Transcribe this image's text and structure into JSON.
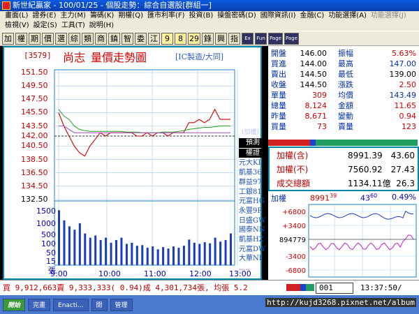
{
  "window_title": "新世紀贏家 - 100/01/25 - 個股走勢：綜合自選股[群組一]",
  "menu": {
    "row1": [
      {
        "label": "畫面(L)",
        "enabled": true
      },
      {
        "label": "證券(E)",
        "enabled": true
      },
      {
        "label": "主力(M)",
        "enabled": true
      },
      {
        "label": "籌碼(K)",
        "enabled": true
      },
      {
        "label": "期權(Q)",
        "enabled": true
      },
      {
        "label": "匯市利率(F)",
        "enabled": true
      },
      {
        "label": "投資(B)",
        "enabled": true
      },
      {
        "label": "操盤密碼(D)",
        "enabled": true
      },
      {
        "label": "國際資訊(I)",
        "enabled": true
      },
      {
        "label": "金融(C)",
        "enabled": true
      },
      {
        "label": "功能選擇(A)",
        "enabled": true
      },
      {
        "label": "功能選擇(J)",
        "enabled": false
      }
    ],
    "row2": [
      {
        "label": "檢視(V)",
        "enabled": true
      },
      {
        "label": "設定(S)",
        "enabled": true
      },
      {
        "label": "工具(T)",
        "enabled": true
      },
      {
        "label": "說明(H)",
        "enabled": true
      }
    ]
  },
  "toolbar": {
    "buttons": [
      "加",
      "權",
      "期",
      "價",
      "選",
      "綜",
      "類",
      "商",
      "鎮",
      "智",
      "委",
      "江",
      "9",
      "8",
      "29",
      "錄",
      "興",
      "指"
    ],
    "extra": [
      "Ex",
      "Fun",
      "Page",
      "Page"
    ]
  },
  "quote": {
    "code": "[3579]",
    "name": "尚志",
    "title": "量價走勢圖",
    "industry": "[IC製造/大同]",
    "rows": [
      {
        "l1": "開盤",
        "v1": "146.00",
        "l2": "振幅",
        "v2": "5.63%",
        "v2c": "red"
      },
      {
        "l1": "買進",
        "v1": "144.00",
        "l2": "最高",
        "v2": "147.00",
        "v2c": "blue"
      },
      {
        "l1": "賣出",
        "v1": "144.50",
        "l2": "最低",
        "v2": "139.00",
        "v2c": "black"
      },
      {
        "l1": "收盤",
        "v1": "144.50",
        "l2": "漲跌",
        "v2": "2.50",
        "v2c": "red"
      },
      {
        "l1": "單量",
        "v1": "309",
        "l2": "均價",
        "v2": "143.49",
        "v2c": "blue"
      },
      {
        "l1": "總量",
        "v1": "8,124",
        "l2": "金額",
        "v2": "11.65",
        "v2c": "red"
      },
      {
        "l1": "昨量",
        "v1": "8,671",
        "l2": "變動",
        "v2": "0.94",
        "v2c": "red"
      },
      {
        "l1": "買量",
        "v1": "73",
        "l2": "賣量",
        "v2": "123",
        "v2c": "red"
      }
    ]
  },
  "price_axis": [
    "151.50",
    "149.50",
    "147.50",
    "145.50",
    "143.50",
    "142.00",
    "140.50",
    "138.50",
    "136.50",
    "134.50",
    "132.50"
  ],
  "volume_axis": [
    "1500",
    "1000",
    "500",
    "100",
    "50",
    "15"
  ],
  "volume_unit": "張",
  "time_axis": [
    "9:00",
    "10:00",
    "11:00",
    "12:00",
    "13:00"
  ],
  "weighted_label": "(加權)",
  "broker_header": "預測",
  "broker_subheader": "權證",
  "brokers": [
    "元大KI",
    "凱基36",
    "群益97",
    "工銀81",
    "元富HG",
    "永豐9P",
    "日盛GW",
    "國泰NN",
    "凱基HZ",
    "元富DW",
    "大華NI",
    "....."
  ],
  "summary": [
    {
      "label": "加權(含)",
      "value": "8991.39",
      "pct": "43.60"
    },
    {
      "label": "加權(不)",
      "value": "7560.92",
      "pct": "27.43"
    },
    {
      "label": "成交總額",
      "value": "1134.11億",
      "pct": "26.3"
    }
  ],
  "mini": {
    "label": "加權",
    "price": "8991",
    "price_sup": "39",
    "change": "43",
    "change_sup": "60",
    "pct": "0.49%",
    "yticks": [
      "+6800",
      "+3400",
      "894779",
      "-3400",
      "-6800"
    ]
  },
  "status": {
    "text": "買 9,912,663賣 9,333,333( 0.94)成 4,301,734張, 均張 5.2",
    "input": "001",
    "time": "13:37:50/"
  },
  "taskbar": {
    "start": "開始",
    "items": [
      "完畫",
      "Enacti...",
      "開",
      "管理"
    ]
  },
  "watermark": "http://kujd3268.pixnet.net/album",
  "chart_data": {
    "type": "line",
    "price_reference": 142.0,
    "ylim": [
      132.5,
      151.5
    ],
    "times": [
      "9:00",
      "9:05",
      "9:10",
      "9:15",
      "9:20",
      "9:25",
      "9:30",
      "9:35",
      "9:40",
      "9:45",
      "9:50",
      "9:55",
      "10:00",
      "10:10",
      "10:20",
      "10:30",
      "10:40",
      "10:50",
      "11:00",
      "11:10",
      "11:20",
      "11:30",
      "11:40",
      "11:50",
      "12:00",
      "12:10",
      "12:20",
      "12:30",
      "12:40",
      "12:50",
      "13:00",
      "13:10",
      "13:20",
      "13:30"
    ],
    "series": [
      {
        "values": [
          145.5,
          143.5,
          142.0,
          140.5,
          139.5,
          139.0,
          140.5,
          141.5,
          142.5,
          142.0,
          142.5,
          142.5,
          142.5,
          142.5,
          142.5,
          142.0,
          142.0,
          142.5,
          142.0,
          142.5,
          142.5,
          142.0,
          142.5,
          142.5,
          142.5,
          144.0,
          144.0,
          144.5,
          144.0,
          144.5,
          146.0,
          144.5,
          144.5,
          144.5
        ]
      },
      {
        "values": [
          146.0,
          145.0,
          144.5,
          143.5,
          143.0,
          142.8,
          142.7,
          142.7,
          142.7,
          142.7,
          142.7,
          142.7,
          142.7,
          142.6,
          142.6,
          142.6,
          142.5,
          142.5,
          142.5,
          142.5,
          142.6,
          142.6,
          142.6,
          142.7,
          142.8,
          143.0,
          143.1,
          143.2,
          143.3,
          143.3,
          143.4,
          143.5,
          143.5,
          143.5
        ]
      },
      {
        "values": [
          143.5,
          143.5,
          143.0,
          142.5,
          142.5,
          142.5,
          142.5,
          142.5,
          142.5,
          142.5,
          142.5,
          142.5,
          142.5,
          142.5,
          142.5,
          142.5,
          142.5,
          142.5,
          142.5,
          142.5,
          142.5,
          142.5,
          142.5,
          142.5,
          142.5,
          142.5,
          142.5,
          142.5,
          142.5,
          142.5,
          142.5,
          142.5,
          142.5,
          142.5
        ]
      }
    ],
    "volume": [
      1200,
      800,
      600,
      500,
      700,
      400,
      300,
      350,
      250,
      300,
      200,
      250,
      300,
      180,
      200,
      150,
      160,
      120,
      140,
      100,
      130,
      110,
      140,
      120,
      150,
      260,
      200,
      180,
      210,
      190,
      300,
      220,
      250,
      400
    ]
  }
}
